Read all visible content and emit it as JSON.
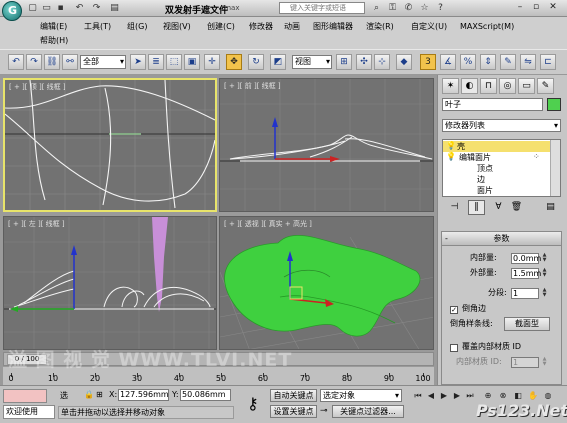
{
  "window": {
    "title": "双发射手遮文件",
    "title_ext": ".max",
    "search_placeholder": "键入关键字或短语"
  },
  "menu": {
    "items": [
      "编辑(E)",
      "工具(T)",
      "组(G)",
      "视图(V)",
      "创建(C)",
      "修改器",
      "动画",
      "图形编辑器",
      "渲染(R)",
      "自定义(U)",
      "MAXScript(M)",
      "帮助(H)"
    ]
  },
  "toolbar": {
    "filter_value": "全部",
    "coord_system_value": "视图",
    "snap_value": "3"
  },
  "viewports": {
    "top": "[ + ][ 顶 ][ 线框 ]",
    "front": "[ + ][ 前 ][ 线框 ]",
    "left": "[ + ][ 左 ][ 线框 ]",
    "persp": "[ + ][ 透视 ][ 真实 + 高光 ]"
  },
  "command_panel": {
    "object_name": "叶子",
    "modifier_list": "修改器列表",
    "stack": [
      "壳",
      "编辑面片",
      "顶点",
      "边",
      "面片"
    ],
    "params": {
      "title": "参数",
      "inner_label": "内部量:",
      "inner_value": "0.0mm",
      "outer_label": "外部量:",
      "outer_value": "1.5mm",
      "segments_label": "分段:",
      "segments_value": "1",
      "bevel_edges_label": "倒角边",
      "bevel_spline_label": "倒角样条线:",
      "surface_button": "截面型",
      "override_label": "覆盖内部材质 ID",
      "inner_mat_label": "内部材质 ID:",
      "inner_mat_value": "1"
    }
  },
  "timeline": {
    "frame_counter": "0 / 100",
    "ticks": [
      "0",
      "10",
      "20",
      "30",
      "40",
      "50",
      "60",
      "70",
      "80",
      "90",
      "100"
    ]
  },
  "status": {
    "welcome": "欢迎使用",
    "selection": "选",
    "prompt": "单击并拖动以选择并移动对象",
    "x_label": "X:",
    "x_value": "127.596mm",
    "y_label": "Y:",
    "y_value": "50.086mm",
    "autokey": "自动关键点",
    "selected_set": "选定对象",
    "set_key": "设置关键点",
    "key_filters": "关键点过滤器..."
  },
  "watermarks": {
    "left": "溢 图 视 觉 WWW.TLVI.NET",
    "right": "Ps123.Net"
  },
  "colors": {
    "active_viewport_border": "#e8e46a",
    "object_color": "#4fd04f",
    "leaf_green": "#39d039"
  }
}
